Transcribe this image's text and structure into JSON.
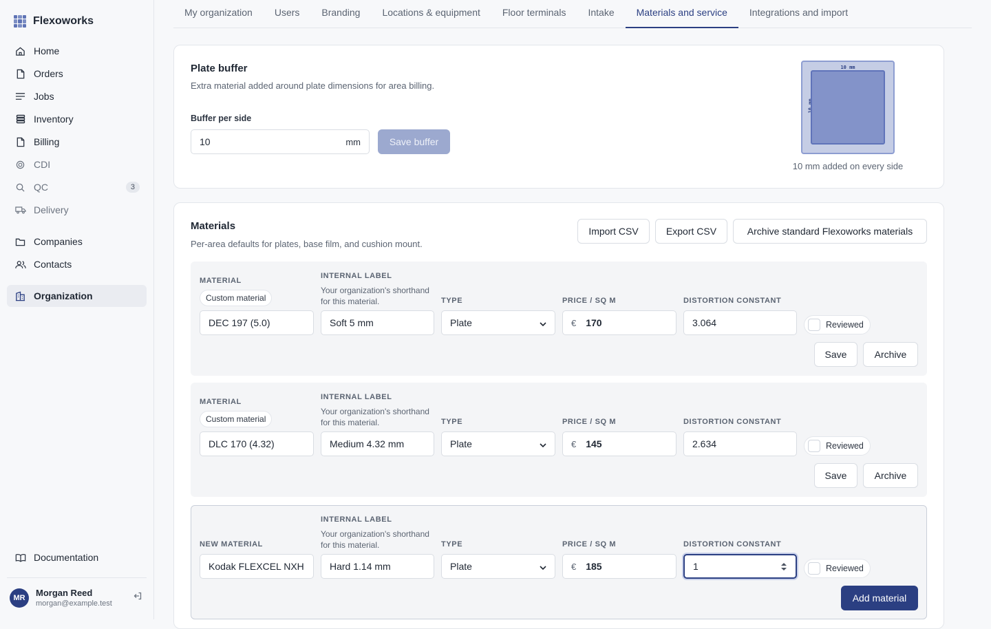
{
  "app": {
    "name": "Flexoworks"
  },
  "sidebar": {
    "items": [
      {
        "label": "Home"
      },
      {
        "label": "Orders"
      },
      {
        "label": "Jobs"
      },
      {
        "label": "Inventory"
      },
      {
        "label": "Billing"
      },
      {
        "label": "CDI"
      },
      {
        "label": "QC",
        "badge": "3"
      },
      {
        "label": "Delivery"
      },
      {
        "label": "Companies"
      },
      {
        "label": "Contacts"
      },
      {
        "label": "Organization"
      },
      {
        "label": "Documentation"
      }
    ],
    "user": {
      "initials": "MR",
      "name": "Morgan Reed",
      "email": "morgan@example.test"
    }
  },
  "tabs": [
    {
      "label": "My organization"
    },
    {
      "label": "Users"
    },
    {
      "label": "Branding"
    },
    {
      "label": "Locations & equipment"
    },
    {
      "label": "Floor terminals"
    },
    {
      "label": "Intake"
    },
    {
      "label": "Materials and service",
      "active": true
    },
    {
      "label": "Integrations and import"
    }
  ],
  "buffer": {
    "title": "Plate buffer",
    "subtitle": "Extra material added around plate dimensions for area billing.",
    "field_label": "Buffer per side",
    "value": "10",
    "unit": "mm",
    "save_label": "Save buffer",
    "preview_dim": "10 mm",
    "preview_caption": "10 mm added on every side"
  },
  "materials": {
    "title": "Materials",
    "subtitle": "Per-area defaults for plates, base film, and cushion mount.",
    "import_label": "Import CSV",
    "export_label": "Export CSV",
    "archive_std_label": "Archive standard Flexoworks materials",
    "headers": {
      "material": "Material",
      "new_material": "New material",
      "internal_label": "Internal label",
      "internal_hint": "Your organization's shorthand for this material.",
      "type": "Type",
      "price": "Price / sq m",
      "distortion": "Distortion constant",
      "reviewed": "Reviewed",
      "currency": "€"
    },
    "rows": [
      {
        "chip": "Custom material",
        "material": "DEC 197 (5.0)",
        "internal_label": "Soft 5 mm",
        "type": "Plate",
        "price": "170",
        "distortion": "3.064",
        "save": "Save",
        "archive": "Archive"
      },
      {
        "chip": "Custom material",
        "material": "DLC 170 (4.32)",
        "internal_label": "Medium 4.32 mm",
        "type": "Plate",
        "price": "145",
        "distortion": "2.634",
        "save": "Save",
        "archive": "Archive"
      }
    ],
    "new_row": {
      "material": "Kodak FLEXCEL NXH",
      "internal_label": "Hard 1.14 mm",
      "type": "Plate",
      "price": "185",
      "distortion": "1",
      "add_label": "Add material"
    }
  }
}
